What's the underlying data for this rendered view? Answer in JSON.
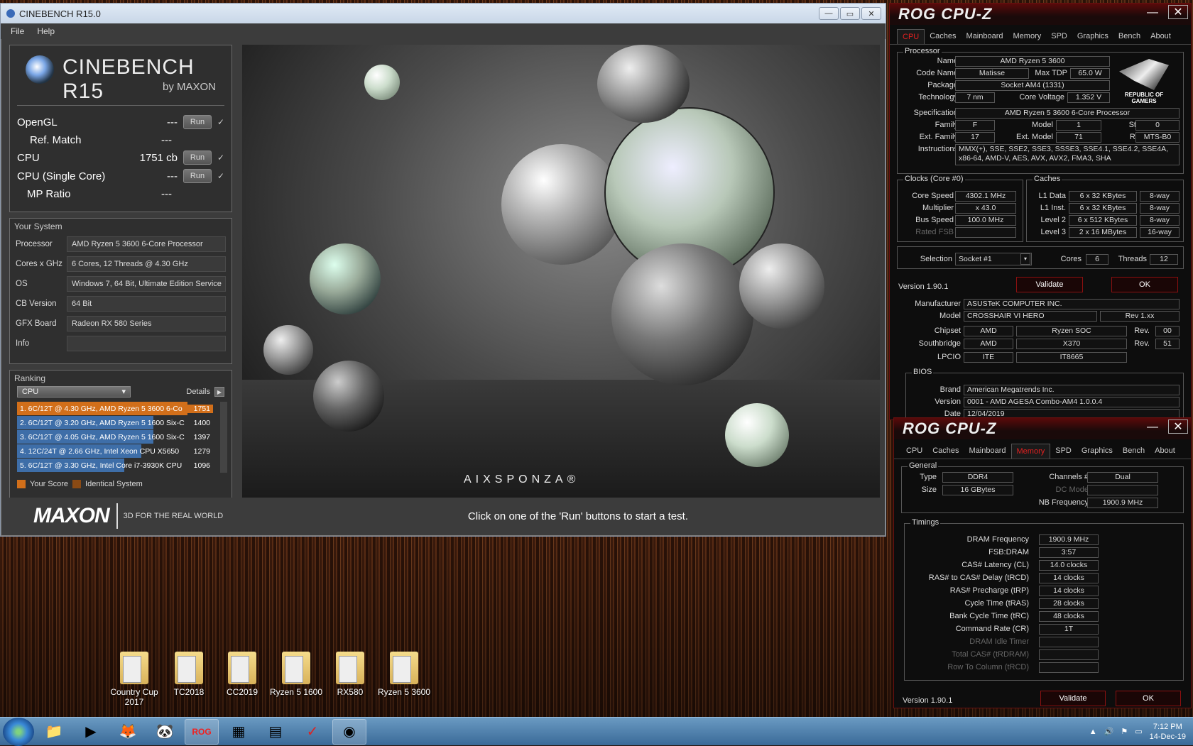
{
  "cinebench": {
    "title": "CINEBENCH R15.0",
    "menu": [
      "File",
      "Help"
    ],
    "logo_title": "CINEBENCH R15",
    "logo_sub": "by MAXON",
    "tests": [
      {
        "label": "OpenGL",
        "value": "---",
        "run": "Run",
        "check": "✓"
      },
      {
        "label": "Ref. Match",
        "value": "---"
      },
      {
        "label": "CPU",
        "value": "1751 cb",
        "run": "Run",
        "check": "✓"
      },
      {
        "label": "CPU (Single Core)",
        "value": "---",
        "run": "Run",
        "check": "✓"
      },
      {
        "label": "MP Ratio",
        "value": "---"
      }
    ],
    "system_title": "Your System",
    "system": [
      {
        "k": "Processor",
        "v": "AMD Ryzen 5 3600 6-Core Processor"
      },
      {
        "k": "Cores x GHz",
        "v": "6 Cores, 12 Threads @ 4.30 GHz"
      },
      {
        "k": "OS",
        "v": "Windows 7, 64 Bit, Ultimate Edition Service"
      },
      {
        "k": "CB Version",
        "v": "64 Bit"
      },
      {
        "k": "GFX Board",
        "v": "Radeon RX 580 Series"
      },
      {
        "k": "Info",
        "v": ""
      }
    ],
    "ranking_title": "Ranking",
    "ranking_select": "CPU",
    "details": "Details",
    "ranking": [
      {
        "text": "1. 6C/12T @ 4.30 GHz, AMD Ryzen 5 3600 6-Co",
        "score": "1751",
        "frac": 1.0
      },
      {
        "text": "2. 6C/12T @ 3.20 GHz, AMD Ryzen 5 1600 Six-C",
        "score": "1400",
        "frac": 0.8
      },
      {
        "text": "3. 6C/12T @ 4.05 GHz, AMD Ryzen 5 1600 Six-C",
        "score": "1397",
        "frac": 0.8
      },
      {
        "text": "4. 12C/24T @ 2.66 GHz, Intel Xeon CPU X5650",
        "score": "1279",
        "frac": 0.73
      },
      {
        "text": "5. 6C/12T @ 3.30 GHz,  Intel Core i7-3930K CPU",
        "score": "1096",
        "frac": 0.63
      }
    ],
    "legend_you": "Your Score",
    "legend_identical": "Identical System",
    "maxon": "MAXON",
    "tagline": "3D FOR THE REAL WORLD",
    "hint": "Click on one of the 'Run' buttons to start a test.",
    "render_brand": "AIXSPONZA®"
  },
  "cpuz1": {
    "title": "ROG CPU-Z",
    "tabs": [
      "CPU",
      "Caches",
      "Mainboard",
      "Memory",
      "SPD",
      "Graphics",
      "Bench",
      "About"
    ],
    "active_tab": "CPU",
    "processor_label": "Processor",
    "name_l": "Name",
    "name": "AMD Ryzen 5 3600",
    "code_l": "Code Name",
    "code": "Matisse",
    "tdp_l": "Max TDP",
    "tdp": "65.0 W",
    "pkg_l": "Package",
    "pkg": "Socket AM4 (1331)",
    "tech_l": "Technology",
    "tech": "7 nm",
    "cv_l": "Core Voltage",
    "cv": "1.352 V",
    "spec_l": "Specification",
    "spec": "AMD Ryzen 5 3600 6-Core Processor",
    "fam_l": "Family",
    "fam": "F",
    "model_l": "Model",
    "model": "1",
    "step_l": "Stepping",
    "step": "0",
    "efam_l": "Ext. Family",
    "efam": "17",
    "emodel_l": "Ext. Model",
    "emodel": "71",
    "rev_l": "Revision",
    "rev": "MTS-B0",
    "instr_l": "Instructions",
    "instr1": "MMX(+), SSE, SSE2, SSE3, SSSE3, SSE4.1, SSE4.2, SSE4A,",
    "instr2": "x86-64, AMD-V, AES, AVX, AVX2, FMA3, SHA",
    "rog_text": "REPUBLIC OF GAMERS",
    "clocks_l": "Clocks (Core #0)",
    "cs_l": "Core Speed",
    "cs": "4302.1 MHz",
    "mul_l": "Multiplier",
    "mul": "x 43.0",
    "bus_l": "Bus Speed",
    "bus": "100.0 MHz",
    "fsb_l": "Rated FSB",
    "fsb": "",
    "caches_l": "Caches",
    "l1d_l": "L1 Data",
    "l1d": "6 x 32 KBytes",
    "l1d_w": "8-way",
    "l1i_l": "L1 Inst.",
    "l1i": "6 x 32 KBytes",
    "l1i_w": "8-way",
    "l2_l": "Level 2",
    "l2": "6 x 512 KBytes",
    "l2_w": "8-way",
    "l3_l": "Level 3",
    "l3": "2 x 16 MBytes",
    "l3_w": "16-way",
    "sel_l": "Selection",
    "sel": "Socket #1",
    "cores_l": "Cores",
    "cores": "6",
    "thr_l": "Threads",
    "thr": "12",
    "version": "Version 1.90.1",
    "validate": "Validate",
    "ok": "OK"
  },
  "mainboard": {
    "man_l": "Manufacturer",
    "man": "ASUSTeK COMPUTER INC.",
    "model_l": "Model",
    "model": "CROSSHAIR VI HERO",
    "rev": "Rev 1.xx",
    "chip_l": "Chipset",
    "chip1": "AMD",
    "chip2": "Ryzen SOC",
    "chiprev_l": "Rev.",
    "chiprev": "00",
    "sb_l": "Southbridge",
    "sb1": "AMD",
    "sb2": "X370",
    "sbrev_l": "Rev.",
    "sbrev": "51",
    "lpc_l": "LPCIO",
    "lpc1": "ITE",
    "lpc2": "IT8665",
    "bios_l": "BIOS",
    "brand_l": "Brand",
    "brand": "American Megatrends Inc.",
    "ver_l": "Version",
    "ver": "0001 - AMD AGESA Combo-AM4 1.0.0.4",
    "date_l": "Date",
    "date": "12/04/2019"
  },
  "cpuz2": {
    "title": "ROG CPU-Z",
    "tabs": [
      "CPU",
      "Caches",
      "Mainboard",
      "Memory",
      "SPD",
      "Graphics",
      "Bench",
      "About"
    ],
    "active_tab": "Memory",
    "general_l": "General",
    "type_l": "Type",
    "type": "DDR4",
    "size_l": "Size",
    "size": "16 GBytes",
    "ch_l": "Channels #",
    "ch": "Dual",
    "dc_l": "DC Mode",
    "dc": "",
    "nb_l": "NB Frequency",
    "nb": "1900.9 MHz",
    "timings_l": "Timings",
    "timings": [
      {
        "k": "DRAM Frequency",
        "v": "1900.9 MHz",
        "dim": false
      },
      {
        "k": "FSB:DRAM",
        "v": "3:57",
        "dim": false
      },
      {
        "k": "CAS# Latency (CL)",
        "v": "14.0 clocks",
        "dim": false
      },
      {
        "k": "RAS# to CAS# Delay (tRCD)",
        "v": "14 clocks",
        "dim": false
      },
      {
        "k": "RAS# Precharge (tRP)",
        "v": "14 clocks",
        "dim": false
      },
      {
        "k": "Cycle Time (tRAS)",
        "v": "28 clocks",
        "dim": false
      },
      {
        "k": "Bank Cycle Time (tRC)",
        "v": "48 clocks",
        "dim": false
      },
      {
        "k": "Command Rate (CR)",
        "v": "1T",
        "dim": false
      },
      {
        "k": "DRAM Idle Timer",
        "v": "",
        "dim": true
      },
      {
        "k": "Total CAS# (tRDRAM)",
        "v": "",
        "dim": true
      },
      {
        "k": "Row To Column (tRCD)",
        "v": "",
        "dim": true
      }
    ],
    "version": "Version 1.90.1",
    "validate": "Validate",
    "ok": "OK"
  },
  "desktop_icons": [
    {
      "label": "Country Cup 2017"
    },
    {
      "label": "TC2018"
    },
    {
      "label": "CC2019"
    },
    {
      "label": "Ryzen 5 1600"
    },
    {
      "label": "RX580"
    },
    {
      "label": "Ryzen 5 3600"
    }
  ],
  "taskbar": {
    "time": "7:12 PM",
    "date": "14-Dec-19"
  }
}
